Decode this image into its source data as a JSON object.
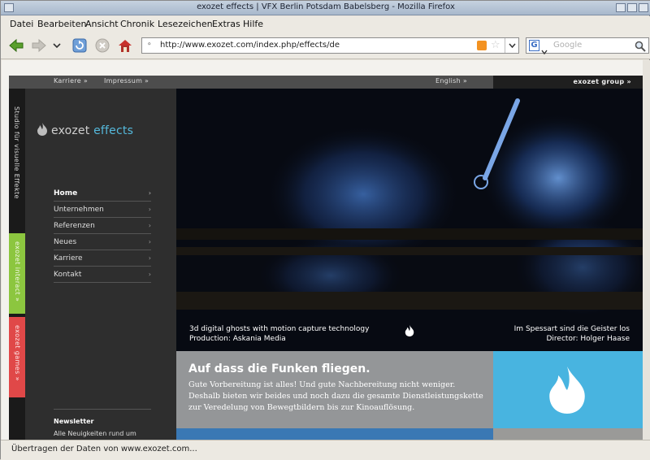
{
  "window": {
    "title": "exozet effects | VFX Berlin Potsdam Babelsberg - Mozilla Firefox"
  },
  "menu": {
    "datei": "Datei",
    "bearbeiten": "Bearbeiten",
    "ansicht": "Ansicht",
    "chronik": "Chronik",
    "lesezeichen": "Lesezeichen",
    "extras": "Extras",
    "hilfe": "Hilfe"
  },
  "navbar": {
    "url": "http://www.exozet.com/index.php/effects/de",
    "search_placeholder": "Google"
  },
  "site": {
    "top_links": {
      "karriere": "Karriere »",
      "impressum": "Impressum »",
      "english": "English »",
      "group": "exozet group »"
    },
    "tagline": "Studio für visuelle Effekte",
    "tab_interact": "exozet interact  »",
    "tab_games": "exozet games  »",
    "logo_word": "exozet",
    "logo_accent": "effects",
    "nav": [
      "Home",
      "Unternehmen",
      "Referenzen",
      "Neues",
      "Karriere",
      "Kontakt"
    ],
    "nav_arrow": "›",
    "newsletter": {
      "title": "Newsletter",
      "text": "Alle Neuigkeiten rund um exozet finden Sie in unserem Newsletter »"
    },
    "hero": {
      "caption_left_1": "3d digital ghosts with motion capture technology",
      "caption_left_2": "Production: Askania Media",
      "caption_right_1": "Im Spessart sind die Geister los",
      "caption_right_2": "Director: Holger Haase"
    },
    "info": {
      "heading": "Auf dass die Funken fliegen.",
      "text": "Gute Vorbereitung ist alles! Und gute Nachbereitung nicht weniger. Deshalb bieten wir beides und noch dazu die gesamte Dienstleistungskette zur Veredelung von Bewegtbildern bis zur Kinoauflösung."
    }
  },
  "status": {
    "text": "Übertragen der Daten von www.exozet.com..."
  },
  "colors": {
    "accent": "#55b9dc",
    "interact_tab": "#8cc63f",
    "games_tab": "#e04848",
    "flame_box": "#48b4e0"
  },
  "icons": {
    "back": "back-arrow-icon",
    "forward": "forward-arrow-icon",
    "history": "chevron-down-icon",
    "reload": "reload-icon",
    "stop": "stop-icon",
    "home": "home-icon",
    "rss": "rss-feed-icon",
    "bookmark": "star-icon",
    "search_engine": "google-icon",
    "search_go": "magnifier-icon",
    "flame": "flame-icon"
  }
}
